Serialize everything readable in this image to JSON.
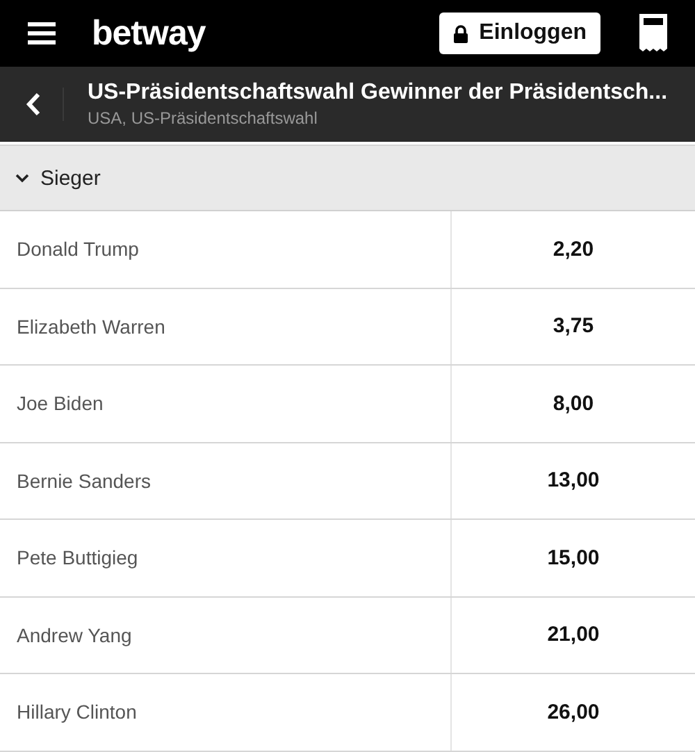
{
  "header": {
    "logo": "betway",
    "login_button": "Einloggen"
  },
  "event": {
    "title": "US-Präsidentschaftswahl Gewinner der Präsidentsch...",
    "subtitle": "USA, US-Präsidentschaftswahl"
  },
  "market": {
    "title": "Sieger",
    "expanded": true,
    "rows": [
      {
        "name": "Donald Trump",
        "odds": "2,20"
      },
      {
        "name": "Elizabeth Warren",
        "odds": "3,75"
      },
      {
        "name": "Joe Biden",
        "odds": "8,00"
      },
      {
        "name": "Bernie Sanders",
        "odds": "13,00"
      },
      {
        "name": "Pete Buttigieg",
        "odds": "15,00"
      },
      {
        "name": "Andrew Yang",
        "odds": "21,00"
      },
      {
        "name": "Hillary Clinton",
        "odds": "26,00"
      }
    ]
  }
}
